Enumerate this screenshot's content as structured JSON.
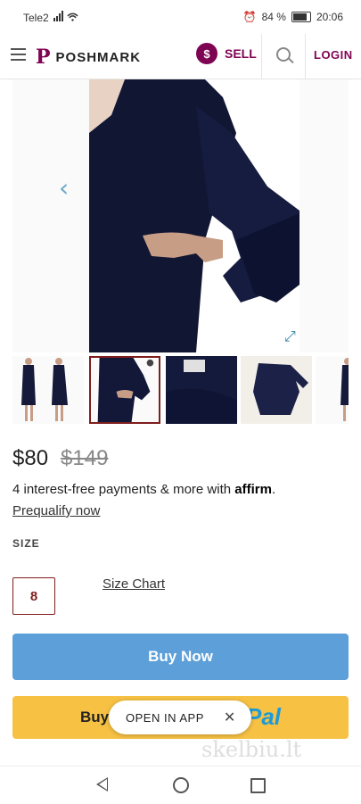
{
  "status_bar": {
    "carrier": "Tele2",
    "battery": "84 %",
    "time": "20:06"
  },
  "header": {
    "brand": "POSHMARK",
    "sell_icon": "$",
    "sell_label": "SELL",
    "login_label": "LOGIN"
  },
  "gallery": {
    "prev_icon": "‹",
    "expand_icon": "⤢",
    "thumbnails": 5,
    "selected_index": 1
  },
  "product": {
    "price_now": "$80",
    "price_original": "$149",
    "installments_text": "4 interest-free payments & more with ",
    "affirm_brand": "affirm",
    "installments_end": ".",
    "prequalify": "Prequalify now",
    "size_heading": "SIZE",
    "size_value": "8",
    "size_chart": "Size Chart"
  },
  "actions": {
    "buy_now": "Buy Now",
    "paypal_buy": "Buy",
    "paypal_brand": "Pal",
    "open_in_app": "OPEN IN APP",
    "close_icon": "✕"
  },
  "watermark": "skelbiu.lt",
  "colors": {
    "brand": "#7f0353",
    "buy_now": "#5d9fd8",
    "paypal": "#f7c244"
  }
}
